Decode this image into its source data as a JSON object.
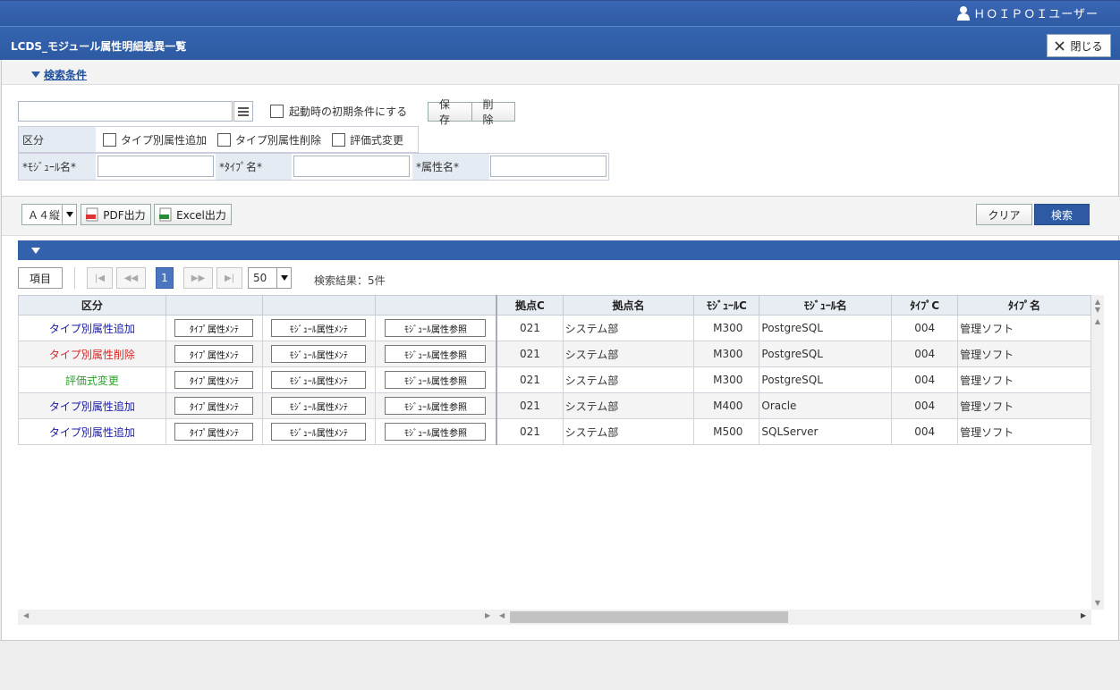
{
  "user": {
    "name": "ＨＯＩＰＯＩユーザー"
  },
  "window": {
    "title": "LCDS_モジュール属性明細差異一覧",
    "close_label": "閉じる"
  },
  "search": {
    "toggle_label": "検索条件",
    "initial_checkbox_label": "起動時の初期条件にする",
    "save_label": "保存",
    "delete_label": "削除",
    "kubun_label": "区分",
    "kubun_options": [
      "タイプ別属性追加",
      "タイプ別属性削除",
      "評価式変更"
    ],
    "module_label": "*ﾓｼﾞｭｰﾙ名*",
    "type_label": "*ﾀｲﾌﾟ名*",
    "attr_label": "*属性名*"
  },
  "toolbar": {
    "paper_value": "Ａ４縦",
    "pdf_label": "PDF出力",
    "excel_label": "Excel出力",
    "clear_label": "クリア",
    "search_label": "検索"
  },
  "pager": {
    "items_label": "項目",
    "current_page": "1",
    "page_size": "50",
    "result_text": "検索結果：5件"
  },
  "grid": {
    "columns": [
      "区分",
      "",
      "",
      "",
      "拠点C",
      "拠点名",
      "ﾓｼﾞｭｰﾙC",
      "ﾓｼﾞｭｰﾙ名",
      "ﾀｲﾌﾟC",
      "ﾀｲﾌﾟ名"
    ],
    "button_labels": [
      "ﾀｲﾌﾟ属性ﾒﾝﾃ",
      "ﾓｼﾞｭｰﾙ属性ﾒﾝﾃ",
      "ﾓｼﾞｭｰﾙ属性参照"
    ],
    "kubun_colors": {
      "add": "#1a1aa6",
      "delete": "#d42a2a",
      "change": "#2aa52a"
    },
    "rows": [
      {
        "kubun": "タイプ別属性追加",
        "kind": "add",
        "kyoten_c": "021",
        "kyoten_name": "システム部",
        "module_c": "M300",
        "module_name": "PostgreSQL",
        "type_c": "004",
        "type_name": "管理ソフト"
      },
      {
        "kubun": "タイプ別属性削除",
        "kind": "delete",
        "kyoten_c": "021",
        "kyoten_name": "システム部",
        "module_c": "M300",
        "module_name": "PostgreSQL",
        "type_c": "004",
        "type_name": "管理ソフト"
      },
      {
        "kubun": "評価式変更",
        "kind": "change",
        "kyoten_c": "021",
        "kyoten_name": "システム部",
        "module_c": "M300",
        "module_name": "PostgreSQL",
        "type_c": "004",
        "type_name": "管理ソフト"
      },
      {
        "kubun": "タイプ別属性追加",
        "kind": "add",
        "kyoten_c": "021",
        "kyoten_name": "システム部",
        "module_c": "M400",
        "module_name": "Oracle",
        "type_c": "004",
        "type_name": "管理ソフト"
      },
      {
        "kubun": "タイプ別属性追加",
        "kind": "add",
        "kyoten_c": "021",
        "kyoten_name": "システム部",
        "module_c": "M500",
        "module_name": "SQLServer",
        "type_c": "004",
        "type_name": "管理ソフト"
      }
    ]
  }
}
